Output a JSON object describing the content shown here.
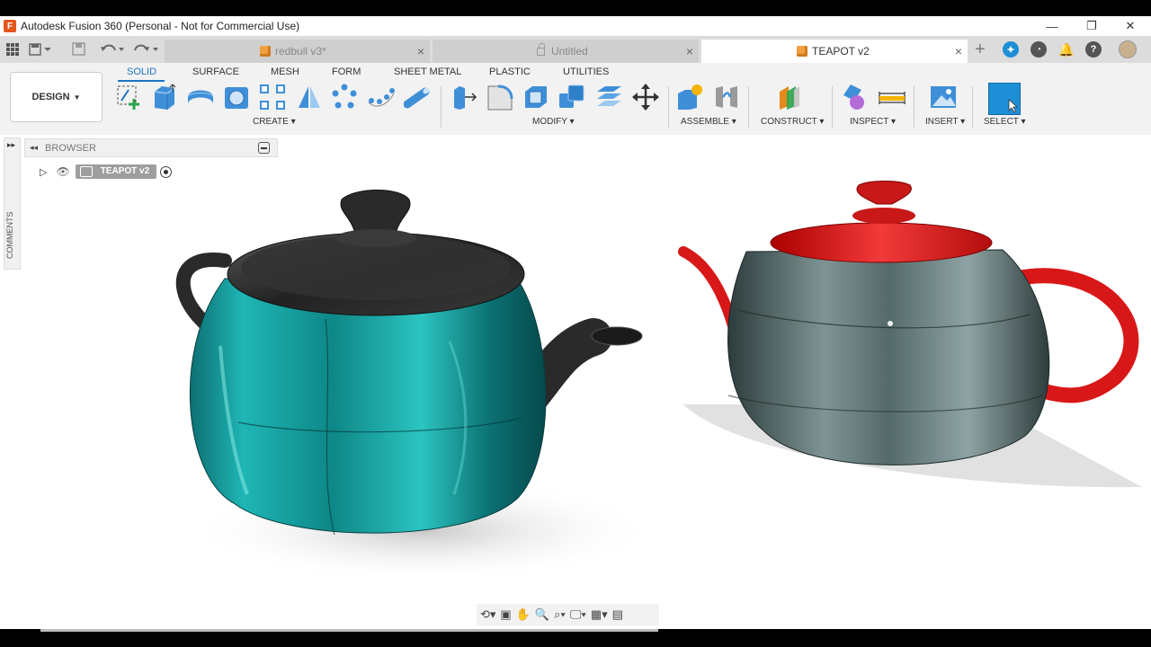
{
  "window": {
    "title": "Autodesk Fusion 360 (Personal - Not for Commercial Use)",
    "controls": {
      "minimize": "—",
      "maximize": "❐",
      "close": "✕"
    }
  },
  "tabs": [
    {
      "label": "redbull v3*",
      "icon": "cube-icon",
      "state": "inactive"
    },
    {
      "label": "Untitled",
      "icon": "lock-icon",
      "state": "inactive"
    },
    {
      "label": "TEAPOT v2",
      "icon": "cube-icon",
      "state": "active"
    }
  ],
  "toolbar": {
    "workspace_button": "DESIGN",
    "workspace_tabs": [
      "SOLID",
      "SURFACE",
      "MESH",
      "FORM",
      "SHEET METAL",
      "PLASTIC",
      "UTILITIES"
    ],
    "active_tab": "SOLID",
    "groups": [
      "CREATE",
      "MODIFY",
      "ASSEMBLE",
      "CONSTRUCT",
      "INSPECT",
      "INSERT",
      "SELECT"
    ]
  },
  "browser": {
    "title": "BROWSER",
    "root_item": "TEAPOT v2",
    "comments_label": "COMMENTS"
  },
  "colors": {
    "accent": "#1a73c8",
    "teal_teapot": "#0e8f8f",
    "gray_teapot": "#4e6262",
    "red_parts": "#d81818",
    "black_parts": "#262626"
  }
}
